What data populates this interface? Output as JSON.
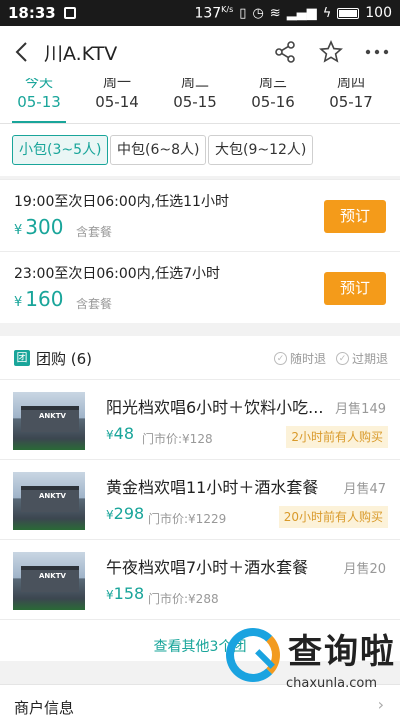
{
  "status_bar": {
    "time": "18:33",
    "speed": "137",
    "speed_unit": "K/s",
    "battery": "100"
  },
  "navbar": {
    "title": "川A.KTV"
  },
  "date_tabs": [
    {
      "weekday": "今天",
      "date": "05-13",
      "active": true
    },
    {
      "weekday": "周一",
      "date": "05-14",
      "active": false
    },
    {
      "weekday": "周二",
      "date": "05-15",
      "active": false
    },
    {
      "weekday": "周三",
      "date": "05-16",
      "active": false
    },
    {
      "weekday": "周四",
      "date": "05-17",
      "active": false
    }
  ],
  "room_types": [
    {
      "label": "小包(3~5人)",
      "active": true
    },
    {
      "label": "中包(6~8人)",
      "active": false
    },
    {
      "label": "大包(9~12人)",
      "active": false
    }
  ],
  "packages": [
    {
      "desc": "19:00至次日06:00内,任选11小时",
      "currency": "¥",
      "price": "300",
      "includes": "含套餐",
      "button": "预订"
    },
    {
      "desc": "23:00至次日06:00内,任选7小时",
      "currency": "¥",
      "price": "160",
      "includes": "含套餐",
      "button": "预订"
    }
  ],
  "group_buy": {
    "icon_text": "团",
    "title": "团购 (6)",
    "tags": [
      "随时退",
      "过期退"
    ],
    "deals": [
      {
        "name": "阳光档欢唱6小时＋饮料小吃...",
        "sold": "月售149",
        "currency": "¥",
        "price": "48",
        "orig": "门市价:¥128",
        "recent": "2小时前有人购买",
        "thumb_text": "ANKTV"
      },
      {
        "name": "黄金档欢唱11小时＋酒水套餐",
        "sold": "月售47",
        "currency": "¥",
        "price": "298",
        "orig": "门市价:¥1229",
        "recent": "20小时前有人购买",
        "thumb_text": "ANKTV"
      },
      {
        "name": "午夜档欢唱7小时＋酒水套餐",
        "sold": "月售20",
        "currency": "¥",
        "price": "158",
        "orig": "门市价:¥288",
        "recent": "",
        "thumb_text": "ANKTV"
      }
    ],
    "more": "查看其他3个团"
  },
  "merchant": {
    "label": "商户信息"
  },
  "watermark": {
    "title": "查询啦",
    "sub": "chaxunla.com"
  },
  "colors": {
    "accent": "#19a59a",
    "book_button": "#f49b1a",
    "recent_bg": "#fcf2d9"
  }
}
